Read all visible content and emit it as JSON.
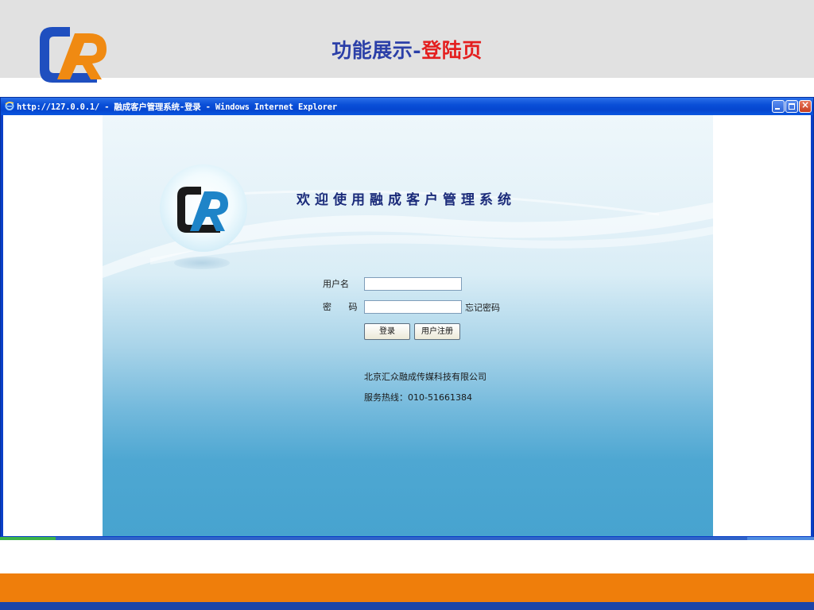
{
  "slide": {
    "title_prefix": "功能展示-",
    "title_highlight": "登陆页"
  },
  "browser": {
    "title": "http://127.0.0.1/ - 融成客户管理系统-登录 - Windows Internet Explorer",
    "icon": "ie-icon",
    "buttons": {
      "minimize": "minimize-icon",
      "maximize": "maximize-icon",
      "close": "×"
    }
  },
  "login": {
    "welcome": "欢迎使用融成客户管理系统",
    "username_label": "用户名",
    "password_label": "密 码",
    "username_value": "",
    "password_value": "",
    "forgot_password": "忘记密码",
    "login_button": "登录",
    "register_button": "用户注册",
    "company": "北京汇众融成传媒科技有限公司",
    "hotline": "服务热线：010-51661384"
  },
  "colors": {
    "title_blue": "#2b3fa8",
    "title_red": "#e41f1f",
    "logo_blue": "#1f4fbf",
    "logo_orange": "#f08a12",
    "orange_band": "#ef7e0b",
    "blue_band": "#1c45a8"
  }
}
